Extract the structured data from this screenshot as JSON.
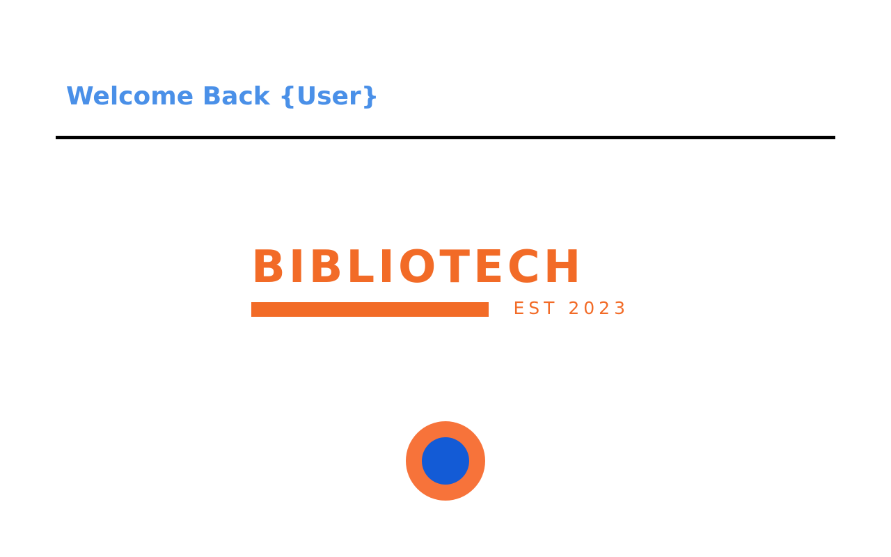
{
  "header": {
    "welcome_text": "Welcome Back {User}"
  },
  "logo": {
    "wordmark": "BIBLIOTECH",
    "tagline": "EST 2023"
  },
  "record_button": {
    "icon": "circle-dot-icon"
  },
  "colors": {
    "welcome_text": "#4a90e8",
    "divider": "#000000",
    "brand_orange": "#f26b27",
    "button_outer": "#f7733a",
    "button_inner": "#135bd6"
  }
}
